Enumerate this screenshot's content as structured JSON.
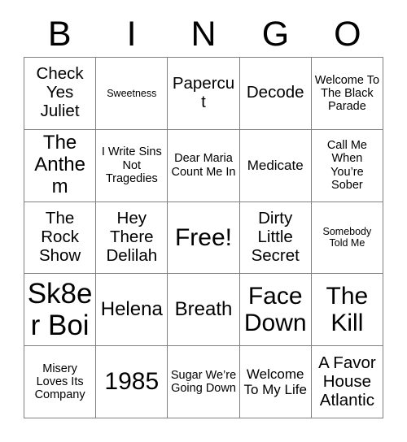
{
  "card": {
    "title_letters": [
      "B",
      "I",
      "N",
      "G",
      "O"
    ],
    "grid_columns": 5,
    "grid_rows": 5,
    "colors": {
      "background": "#ffffff",
      "text": "#000000",
      "border": "#808080"
    },
    "cells": [
      {
        "text": "Check Yes Juliet",
        "size": "l",
        "row": 1,
        "col": 1,
        "free": false
      },
      {
        "text": "Sweetness",
        "size": "xs",
        "row": 1,
        "col": 2,
        "free": false
      },
      {
        "text": "Papercut",
        "size": "l",
        "row": 1,
        "col": 3,
        "free": false
      },
      {
        "text": "Decode",
        "size": "l",
        "row": 1,
        "col": 4,
        "free": false
      },
      {
        "text": "Welcome To The Black Parade",
        "size": "s",
        "row": 1,
        "col": 5,
        "free": false
      },
      {
        "text": "The Anthem",
        "size": "xl",
        "row": 2,
        "col": 1,
        "free": false
      },
      {
        "text": "I Write Sins Not Tragedies",
        "size": "s",
        "row": 2,
        "col": 2,
        "free": false
      },
      {
        "text": "Dear Maria Count Me In",
        "size": "s",
        "row": 2,
        "col": 3,
        "free": false
      },
      {
        "text": "Medicate",
        "size": "m",
        "row": 2,
        "col": 4,
        "free": false
      },
      {
        "text": "Call Me When You’re Sober",
        "size": "s",
        "row": 2,
        "col": 5,
        "free": false
      },
      {
        "text": "The Rock Show",
        "size": "l",
        "row": 3,
        "col": 1,
        "free": false
      },
      {
        "text": "Hey There Delilah",
        "size": "l",
        "row": 3,
        "col": 2,
        "free": false
      },
      {
        "text": "Free!",
        "size": "xxl",
        "row": 3,
        "col": 3,
        "free": true
      },
      {
        "text": "Dirty Little Secret",
        "size": "l",
        "row": 3,
        "col": 4,
        "free": false
      },
      {
        "text": "Somebody Told Me",
        "size": "xs",
        "row": 3,
        "col": 5,
        "free": false
      },
      {
        "text": "Sk8er Boi",
        "size": "huge",
        "row": 4,
        "col": 1,
        "free": false
      },
      {
        "text": "Helena",
        "size": "xl",
        "row": 4,
        "col": 2,
        "free": false
      },
      {
        "text": "Breath",
        "size": "xl",
        "row": 4,
        "col": 3,
        "free": false
      },
      {
        "text": "Face Down",
        "size": "xxl",
        "row": 4,
        "col": 4,
        "free": false
      },
      {
        "text": "The Kill",
        "size": "xxl",
        "row": 4,
        "col": 5,
        "free": false
      },
      {
        "text": "Misery Loves Its Company",
        "size": "s",
        "row": 5,
        "col": 1,
        "free": false
      },
      {
        "text": "1985",
        "size": "xxl",
        "row": 5,
        "col": 2,
        "free": false
      },
      {
        "text": "Sugar We’re Going Down",
        "size": "s",
        "row": 5,
        "col": 3,
        "free": false
      },
      {
        "text": "Welcome To My Life",
        "size": "m",
        "row": 5,
        "col": 4,
        "free": false
      },
      {
        "text": "A Favor House Atlantic",
        "size": "l",
        "row": 5,
        "col": 5,
        "free": false
      }
    ]
  }
}
